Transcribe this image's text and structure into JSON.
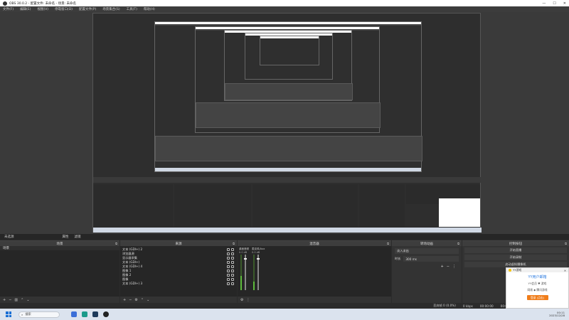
{
  "window": {
    "title": "OBS 30.0.2 - 配置文件: 未命名 - 场景: 未命名",
    "minimize": "—",
    "maximize": "☐",
    "close": "✕"
  },
  "menu": [
    "文件(F)",
    "编辑(E)",
    "视图(V)",
    "停靠窗口(D)",
    "配置文件(P)",
    "场景集合(S)",
    "工具(T)",
    "帮助(H)"
  ],
  "scene_info": {
    "label": "未选源",
    "properties": "属性",
    "filters": "滤镜"
  },
  "docks": {
    "scenes": {
      "title": "场景",
      "items": [
        "场景"
      ]
    },
    "sources": {
      "title": "来源",
      "items": [
        "文本 (GDI+) 2",
        "浏览器源",
        "显示器采集",
        "文本 (GDI+)",
        "文本 (GDI+) 4",
        "图像 1",
        "图像 2",
        "图像",
        "文本 (GDI+) 3"
      ]
    },
    "mixer": {
      "title": "混音器",
      "channels": [
        {
          "name": "桌面音频",
          "db": "0.0 dB",
          "level": 0.4,
          "fader": 0.9
        },
        {
          "name": "麦克风/Aux",
          "db": "0.0 dB",
          "level": 0.25,
          "fader": 0.9
        }
      ]
    },
    "transitions": {
      "title": "转场动画",
      "type": "淡入淡出",
      "duration_label": "时长",
      "duration": "300 ms"
    },
    "controls": {
      "title": "控制按钮",
      "buttons": [
        "开始直播",
        "开始录制",
        "启动虚拟摄像机"
      ]
    }
  },
  "status": {
    "dropped": "丢弃帧 0 (0.0%)",
    "bitrate": "0 kbps",
    "stream_time": "00:00:00",
    "rec_time": "00:00:00",
    "cpu": "CPU: 0.7%, 30.00 / 30.00 FPS"
  },
  "taskbar": {
    "search": "搜索",
    "time": "00:11",
    "date": "2023/12/28"
  },
  "popup": {
    "app": "YY游戏",
    "title": "YY用户邮箱",
    "line1": "YY会员  ♥  游戏",
    "line2": "网易  ◆  腾讯游戏",
    "button": "登录 (点击)"
  },
  "colors": {
    "accent": "#f07d1a",
    "meter": "#5dbb3b",
    "popup_title": "#2f7de1"
  }
}
